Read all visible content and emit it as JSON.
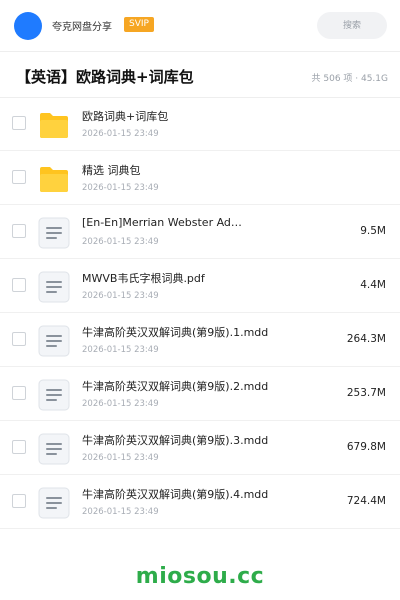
{
  "header": {
    "brand": "夸克网盘分享",
    "badge": "SVIP",
    "search_placeholder": "搜索"
  },
  "folder": {
    "title": "【英语】欧路词典+词库包",
    "summary": "共 506 项 · 45.1G"
  },
  "files": [
    {
      "type": "folder",
      "icon": "folder-icon",
      "name": "欧路词典+词库包",
      "date": "2026-01-15 23:49",
      "size": ""
    },
    {
      "type": "folder",
      "icon": "folder-icon",
      "name": "精选 词典包",
      "date": "2026-01-15 23:49",
      "size": ""
    },
    {
      "type": "file",
      "icon": "document-icon",
      "name": "[En-En]Merrian Webster Ad…",
      "date": "2026-01-15 23:49",
      "size": "9.5M"
    },
    {
      "type": "file",
      "icon": "document-icon",
      "name": "MWVB韦氏字根词典.pdf",
      "date": "2026-01-15 23:49",
      "size": "4.4M"
    },
    {
      "type": "file",
      "icon": "document-icon",
      "name": "牛津高阶英汉双解词典(第9版).1.mdd",
      "date": "2026-01-15 23:49",
      "size": "264.3M"
    },
    {
      "type": "file",
      "icon": "document-icon",
      "name": "牛津高阶英汉双解词典(第9版).2.mdd",
      "date": "2026-01-15 23:49",
      "size": "253.7M"
    },
    {
      "type": "file",
      "icon": "document-icon",
      "name": "牛津高阶英汉双解词典(第9版).3.mdd",
      "date": "2026-01-15 23:49",
      "size": "679.8M"
    },
    {
      "type": "file",
      "icon": "document-icon",
      "name": "牛津高阶英汉双解词典(第9版).4.mdd",
      "date": "2026-01-15 23:49",
      "size": "724.4M"
    }
  ],
  "watermark": "miosou.cc",
  "colors": {
    "avatar": "#1f7bff",
    "svip_badge": "#f6a623",
    "folder": "#ffc41f",
    "watermark": "#2eac4a"
  }
}
